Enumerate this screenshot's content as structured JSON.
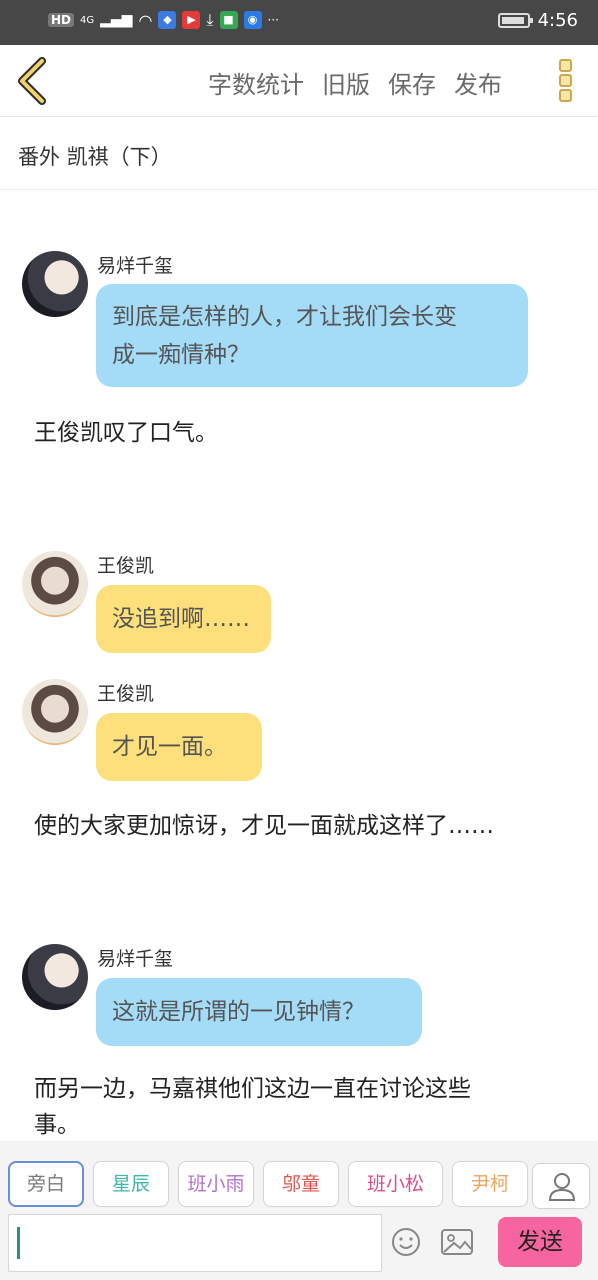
{
  "status_bar": {
    "network": "HD",
    "signal": "4G",
    "time": "4:56",
    "more": "···"
  },
  "toolbar": {
    "actions": [
      "字数统计",
      "旧版",
      "保存",
      "发布"
    ]
  },
  "chapter": {
    "title": "番外   凯祺（下）"
  },
  "messages": [
    {
      "type": "dialogue",
      "speaker": "易烊千玺",
      "color": "blue",
      "lines": [
        "到底是怎样的人，才让我们会长变",
        "成一痴情种？"
      ]
    },
    {
      "type": "narration",
      "text": "王俊凯叹了口气。"
    },
    {
      "type": "dialogue",
      "speaker": "王俊凯",
      "color": "yellow",
      "lines": [
        "没追到啊……"
      ]
    },
    {
      "type": "dialogue",
      "speaker": "王俊凯",
      "color": "yellow",
      "lines": [
        "才见一面。"
      ]
    },
    {
      "type": "narration",
      "text": "使的大家更加惊讶，才见一面就成这样了……"
    },
    {
      "type": "dialogue",
      "speaker": "易烊千玺",
      "color": "blue",
      "lines": [
        "这就是所谓的一见钟情？"
      ]
    },
    {
      "type": "narration",
      "lines": [
        "而另一边，马嘉祺他们这边一直在讨论这些",
        "事。"
      ]
    }
  ],
  "characters": [
    {
      "label": "旁白",
      "color": "#7a7a7a"
    },
    {
      "label": "星辰",
      "color": "#3fb6ae"
    },
    {
      "label": "班小雨",
      "color": "#b571c9"
    },
    {
      "label": "邬童",
      "color": "#e0564e"
    },
    {
      "label": "班小松",
      "color": "#d6508f"
    },
    {
      "label": "尹柯",
      "color": "#f2a35c"
    }
  ],
  "composer": {
    "input_value": "",
    "send_label": "发送"
  },
  "colors": {
    "blue_bubble": "#a4dbf7",
    "yellow_bubble": "#fde07c",
    "send_button": "#f765a0"
  }
}
